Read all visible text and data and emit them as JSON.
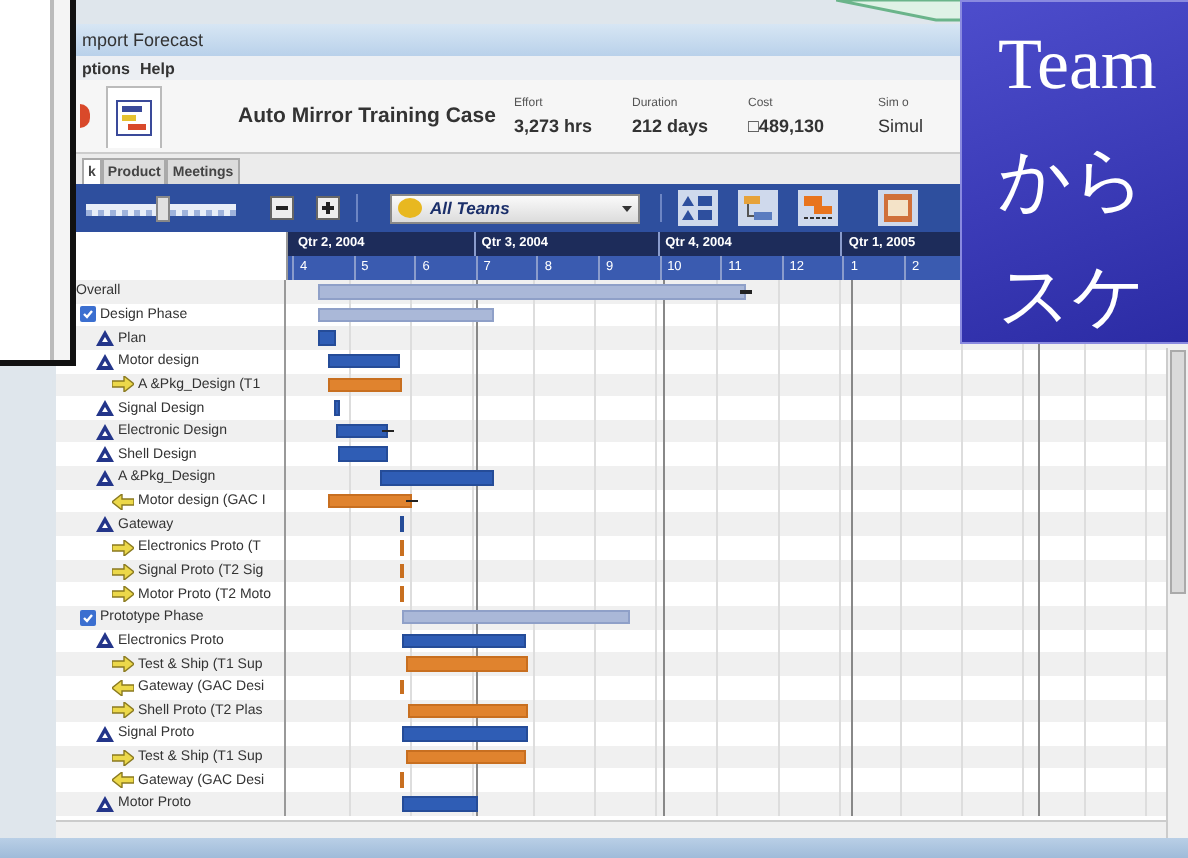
{
  "window": {
    "title": "mport Forecast"
  },
  "menu": [
    "ptions",
    "Help"
  ],
  "project": {
    "name": "Auto Mirror Training Case",
    "stats": [
      {
        "label": "Effort",
        "value": "3,273 hrs"
      },
      {
        "label": "Duration",
        "value": "212 days"
      },
      {
        "label": "Cost",
        "value": "□489,130"
      },
      {
        "label": "Sim o",
        "value": "Simul"
      }
    ]
  },
  "tabs": [
    {
      "label": "k",
      "selected": true
    },
    {
      "label": "Product",
      "selected": false
    },
    {
      "label": "Meetings",
      "selected": false
    }
  ],
  "toolbar": {
    "zoom": {
      "level": 0.5
    },
    "team_filter": "All Teams"
  },
  "gantt": {
    "quarters": [
      "Qtr 2, 2004",
      "Qtr 3, 2004",
      "Qtr 4, 2004",
      "Qtr 1, 2005"
    ],
    "tasks": [
      {
        "name": "Overall",
        "kind": "summary",
        "marker": true,
        "children": [
          {
            "name": "Design Phase",
            "kind": "phase",
            "children": [
              {
                "name": "Plan",
                "kind": "task"
              },
              {
                "name": "Motor design",
                "kind": "task",
                "children": [
                  {
                    "name": "A &Pkg_Design (T1",
                    "kind": "assignment",
                    "reversed": false
                  }
                ]
              },
              {
                "name": "Signal Design",
                "kind": "task"
              },
              {
                "name": "Electronic Design",
                "kind": "task",
                "marker": true
              },
              {
                "name": "Shell Design",
                "kind": "task"
              },
              {
                "name": "A &Pkg_Design",
                "kind": "task",
                "children": [
                  {
                    "name": "Motor design (GAC I",
                    "kind": "assignment",
                    "reversed": true,
                    "marker": true
                  }
                ]
              },
              {
                "name": "Gateway",
                "kind": "task",
                "children": [
                  {
                    "name": "Electronics Proto (T",
                    "kind": "assignment",
                    "reversed": false
                  },
                  {
                    "name": "Signal Proto (T2 Sig",
                    "kind": "assignment",
                    "reversed": false
                  },
                  {
                    "name": "Motor Proto (T2 Moto",
                    "kind": "assignment",
                    "reversed": false
                  }
                ]
              }
            ]
          },
          {
            "name": "Prototype Phase",
            "kind": "phase",
            "children": [
              {
                "name": "Electronics Proto",
                "kind": "task",
                "children": [
                  {
                    "name": "Test & Ship (T1 Sup",
                    "kind": "assignment",
                    "reversed": false
                  },
                  {
                    "name": "Gateway (GAC Desi",
                    "kind": "assignment",
                    "reversed": true
                  },
                  {
                    "name": "Shell Proto (T2 Plas",
                    "kind": "assignment",
                    "reversed": false
                  }
                ]
              },
              {
                "name": "Signal Proto",
                "kind": "task",
                "children": [
                  {
                    "name": "Test & Ship (T1 Sup",
                    "kind": "assignment",
                    "reversed": false
                  },
                  {
                    "name": "Gateway (GAC Desi",
                    "kind": "assignment",
                    "reversed": true
                  }
                ]
              },
              {
                "name": "Motor Proto",
                "kind": "task"
              }
            ]
          }
        ]
      }
    ],
    "months": [
      "4",
      "5",
      "6",
      "7",
      "8",
      "9",
      "10",
      "11",
      "12",
      "1",
      "2"
    ]
  },
  "callout": {
    "lines": [
      "Team",
      "から",
      "スケ"
    ]
  }
}
